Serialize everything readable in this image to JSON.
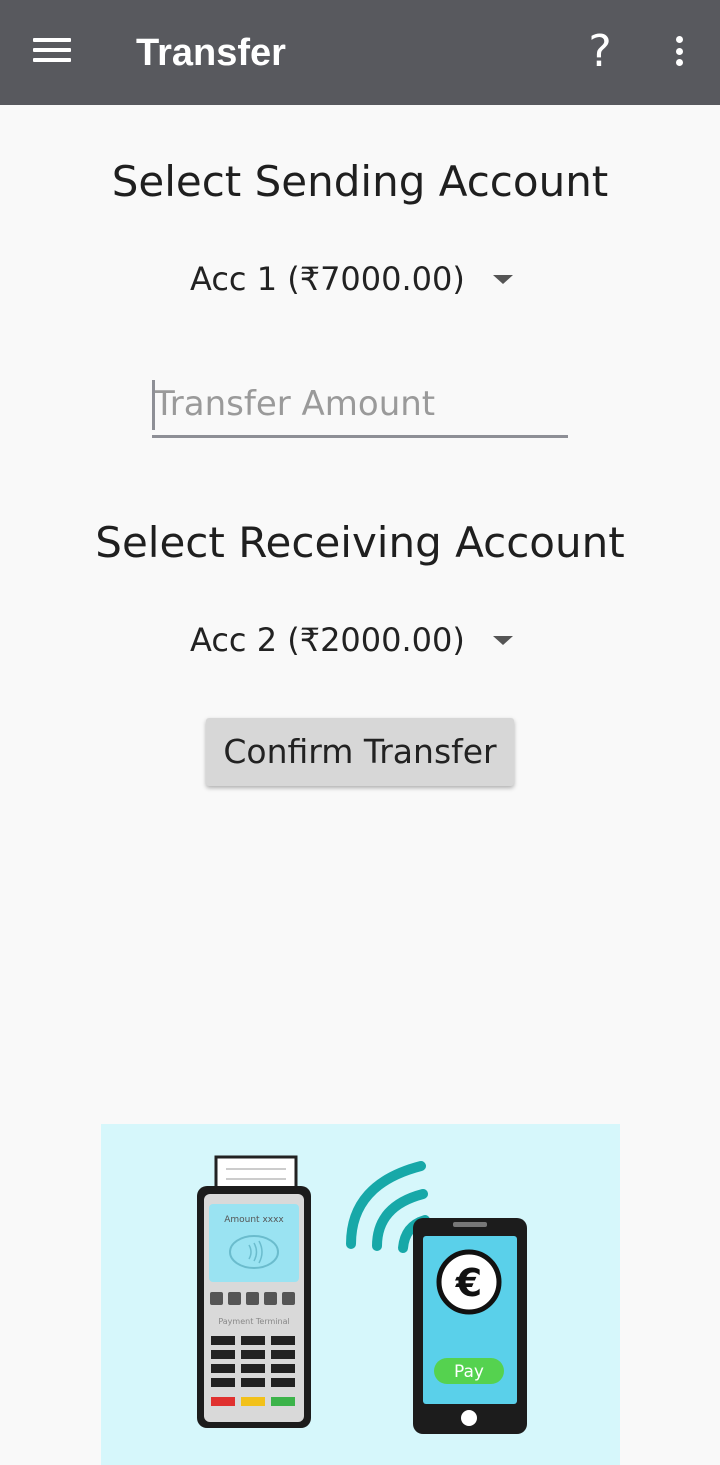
{
  "appbar": {
    "title": "Transfer",
    "help_label": "?",
    "menu_icon": "hamburger-menu-icon",
    "overflow_icon": "more-vert-icon",
    "background": "#58595e"
  },
  "sending": {
    "heading": "Select Sending Account",
    "selected": "Acc 1 (₹7000.00)"
  },
  "amount": {
    "placeholder": "Transfer Amount",
    "value": ""
  },
  "receiving": {
    "heading": "Select Receiving Account",
    "selected": "Acc 2 (₹2000.00)"
  },
  "confirm_label": "Confirm Transfer",
  "illustration": {
    "terminal_screen_text": "Amount xxxx",
    "terminal_label": "Payment Terminal",
    "phone_button": "Pay",
    "currency_symbol": "€",
    "background": "#d6f7fb"
  }
}
